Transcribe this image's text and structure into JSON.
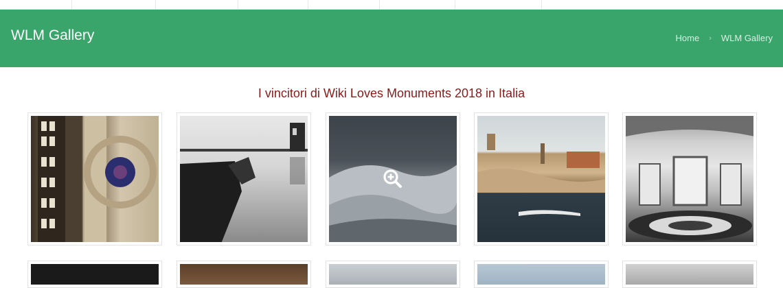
{
  "header": {
    "title": "WLM Gallery",
    "breadcrumb": {
      "home": "Home",
      "separator": "›",
      "current": "WLM Gallery"
    },
    "banner_color": "#3aa56b"
  },
  "main": {
    "heading": "I vincitori di Wiki Loves Monuments 2018 in Italia",
    "heading_color": "#8b1a1a"
  },
  "gallery": {
    "hover_icon": "zoom-in-icon",
    "row1": [
      "photo-1",
      "photo-2",
      "photo-3",
      "photo-4",
      "photo-5"
    ],
    "row2": [
      "photo-6",
      "photo-7",
      "photo-8",
      "photo-9",
      "photo-10"
    ]
  }
}
